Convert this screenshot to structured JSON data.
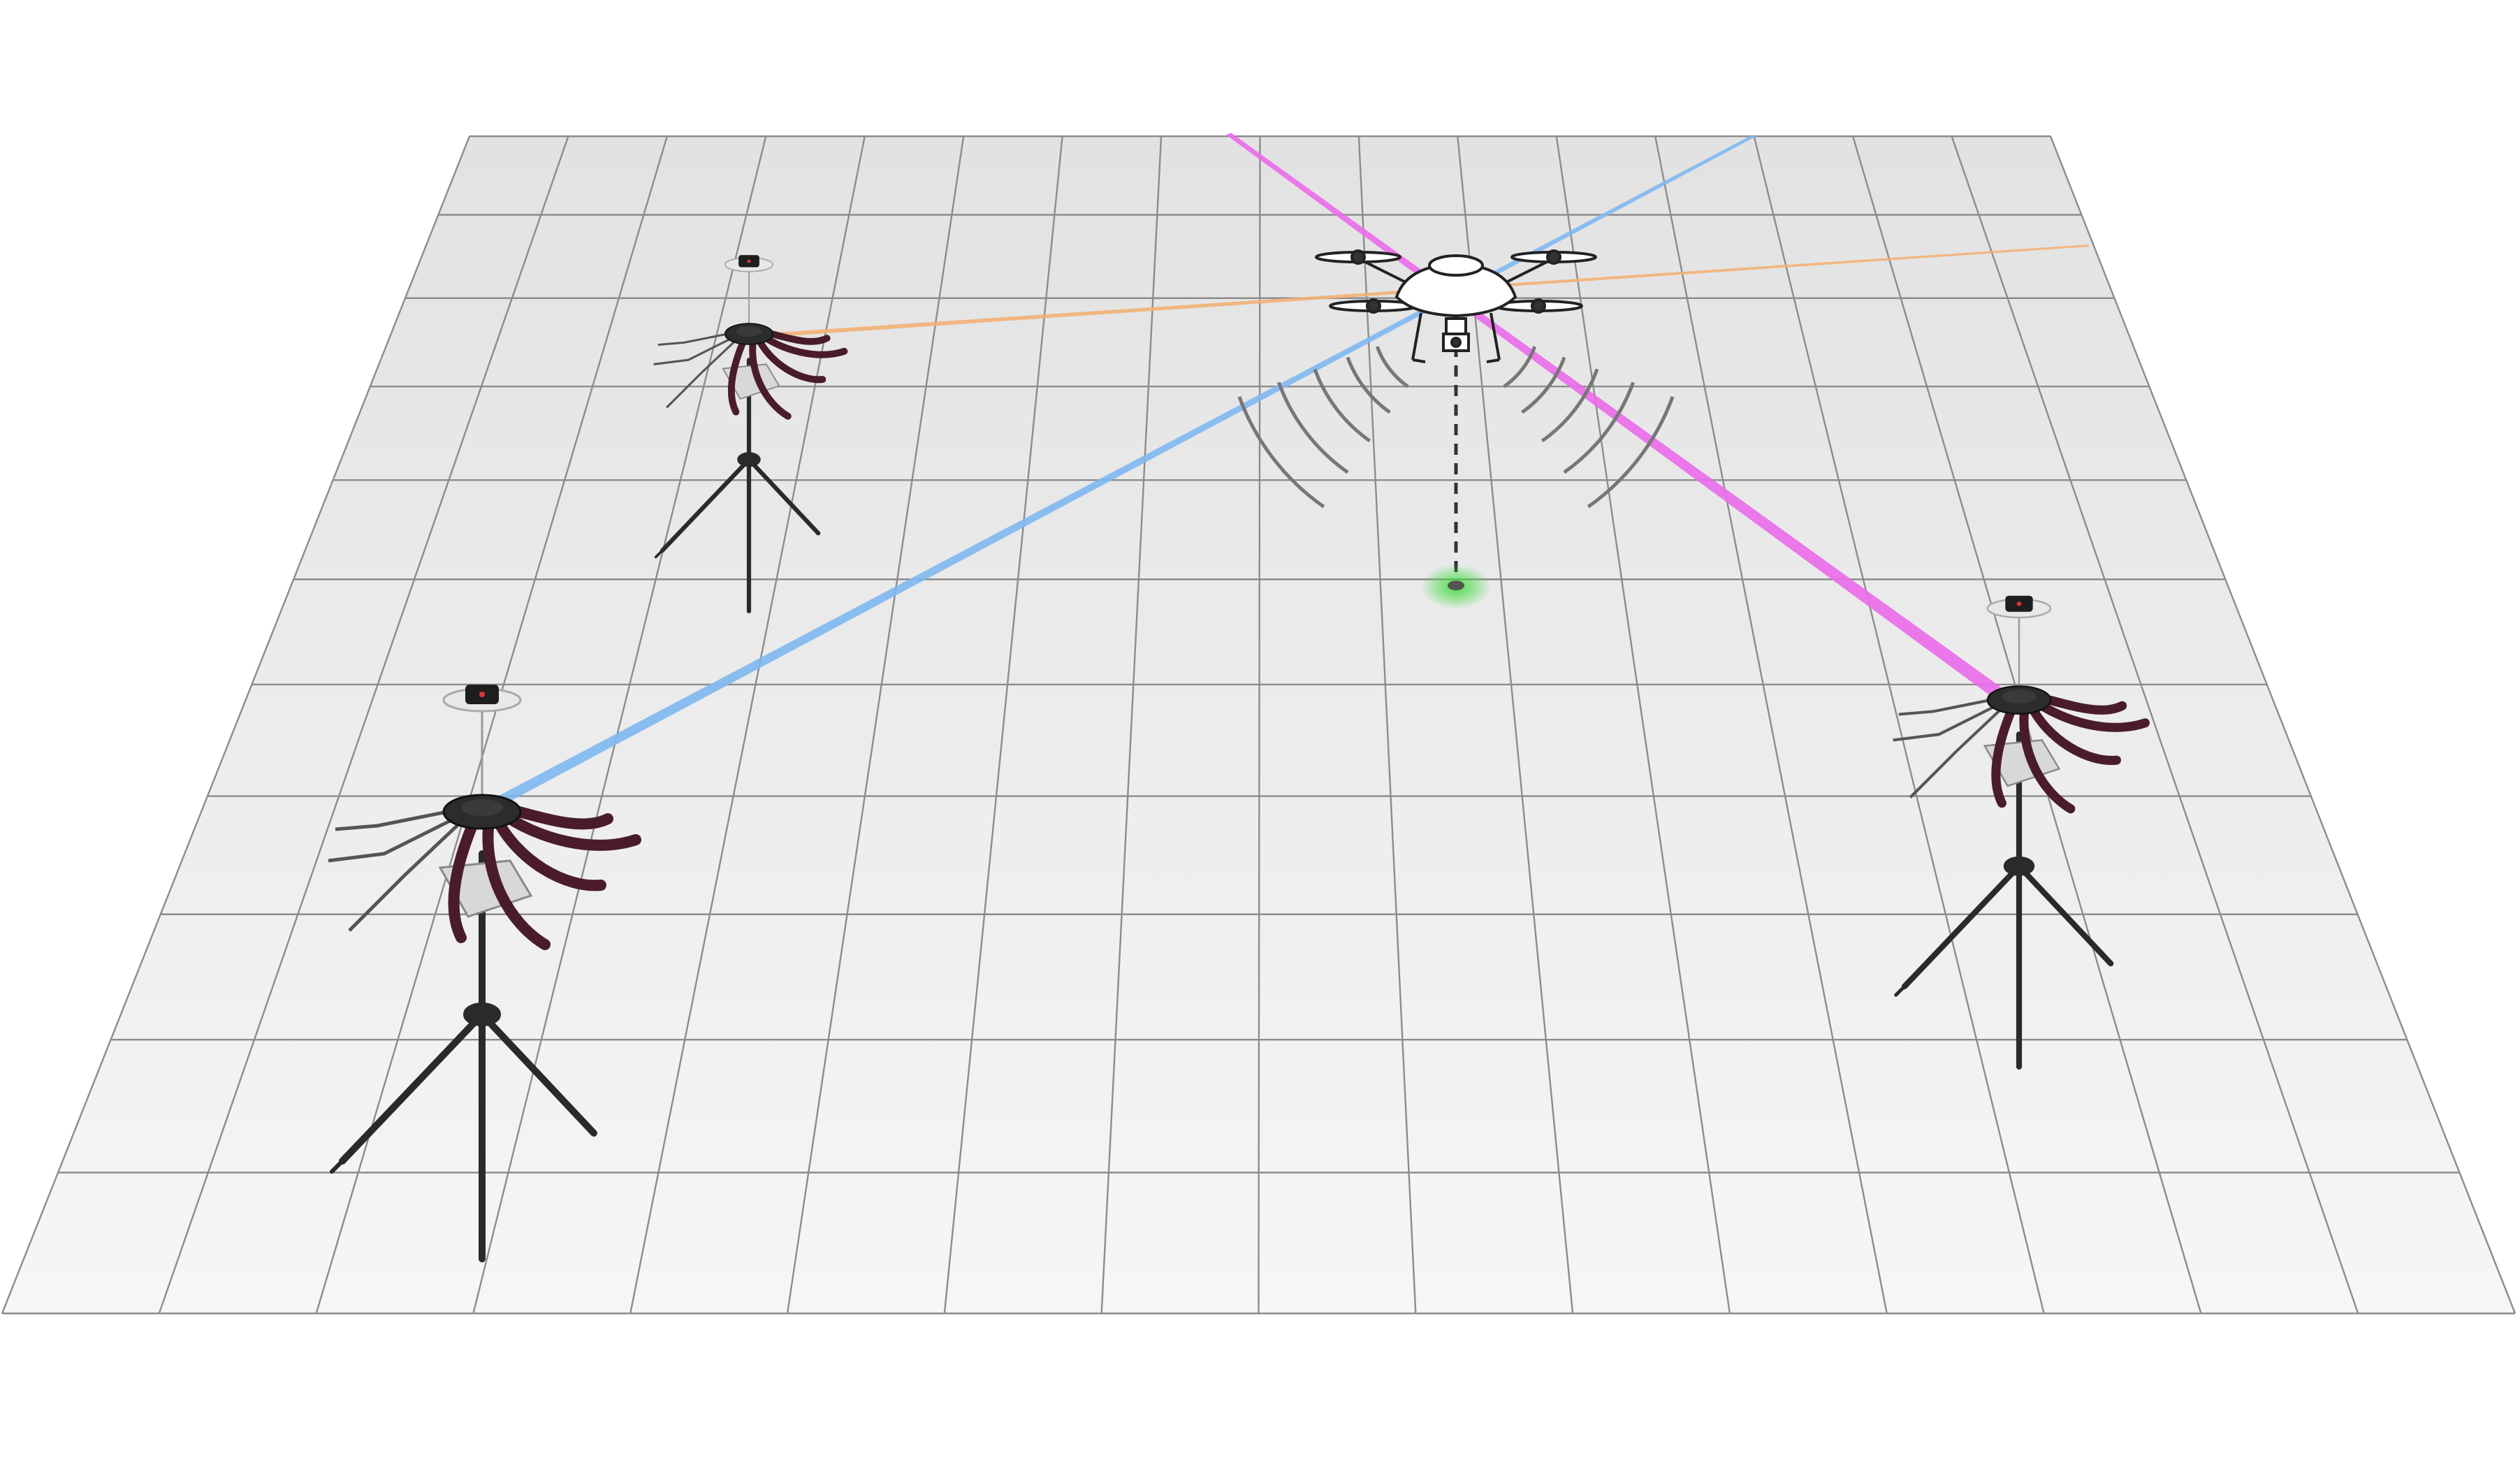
{
  "scene": {
    "floor_grid": {
      "columns": 16,
      "rows": 11
    },
    "colors": {
      "background": "#ffffff",
      "floor_near": "#f6f6f6",
      "floor_far": "#e2e2e2",
      "grid_line": "#8c8c8c",
      "beam_blue": "#7fb8f0",
      "beam_orange": "#f2b074",
      "beam_magenta": "#ea6cea",
      "ground_target": "#3ddc3d",
      "signal_wave": "#777777",
      "station_dark": "#2a2a2a",
      "station_arm": "#4a1c2a"
    },
    "items": {
      "drone": {
        "icon": "quadcopter-drone-icon"
      },
      "ground_target": {
        "icon": "landing-target-icon"
      },
      "signal_waves": {
        "icon": "radio-wave-icon"
      },
      "stations": [
        {
          "id": "far-left",
          "icon": "lighthouse-base-station-icon",
          "beam": "orange"
        },
        {
          "id": "near-left",
          "icon": "lighthouse-base-station-icon",
          "beam": "blue"
        },
        {
          "id": "right",
          "icon": "lighthouse-base-station-icon",
          "beam": "magenta"
        }
      ]
    }
  }
}
